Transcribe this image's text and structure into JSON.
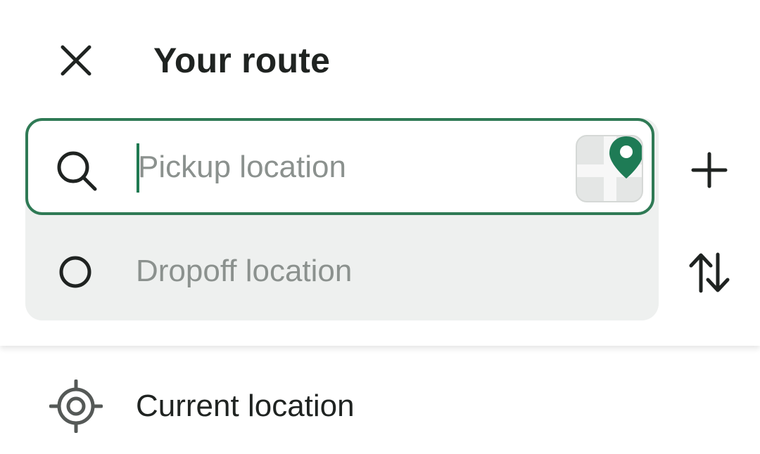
{
  "header": {
    "title": "Your route",
    "close_icon": "close-icon"
  },
  "route": {
    "pickup": {
      "value": "",
      "placeholder": "Pickup location",
      "leading_icon": "search-icon",
      "trailing_icon": "map-pin-icon"
    },
    "dropoff": {
      "placeholder": "Dropoff location",
      "leading_icon": "circle-icon"
    },
    "add_stop_icon": "plus-icon",
    "swap_icon": "swap-arrows-icon"
  },
  "suggestions": [
    {
      "label": "Current location",
      "icon": "crosshair-icon"
    }
  ],
  "colors": {
    "accent": "#2f7a55",
    "pin": "#1e7b55",
    "card_background": "#eef0ef",
    "placeholder_text": "#8b918e",
    "primary_text": "#1f2321"
  }
}
